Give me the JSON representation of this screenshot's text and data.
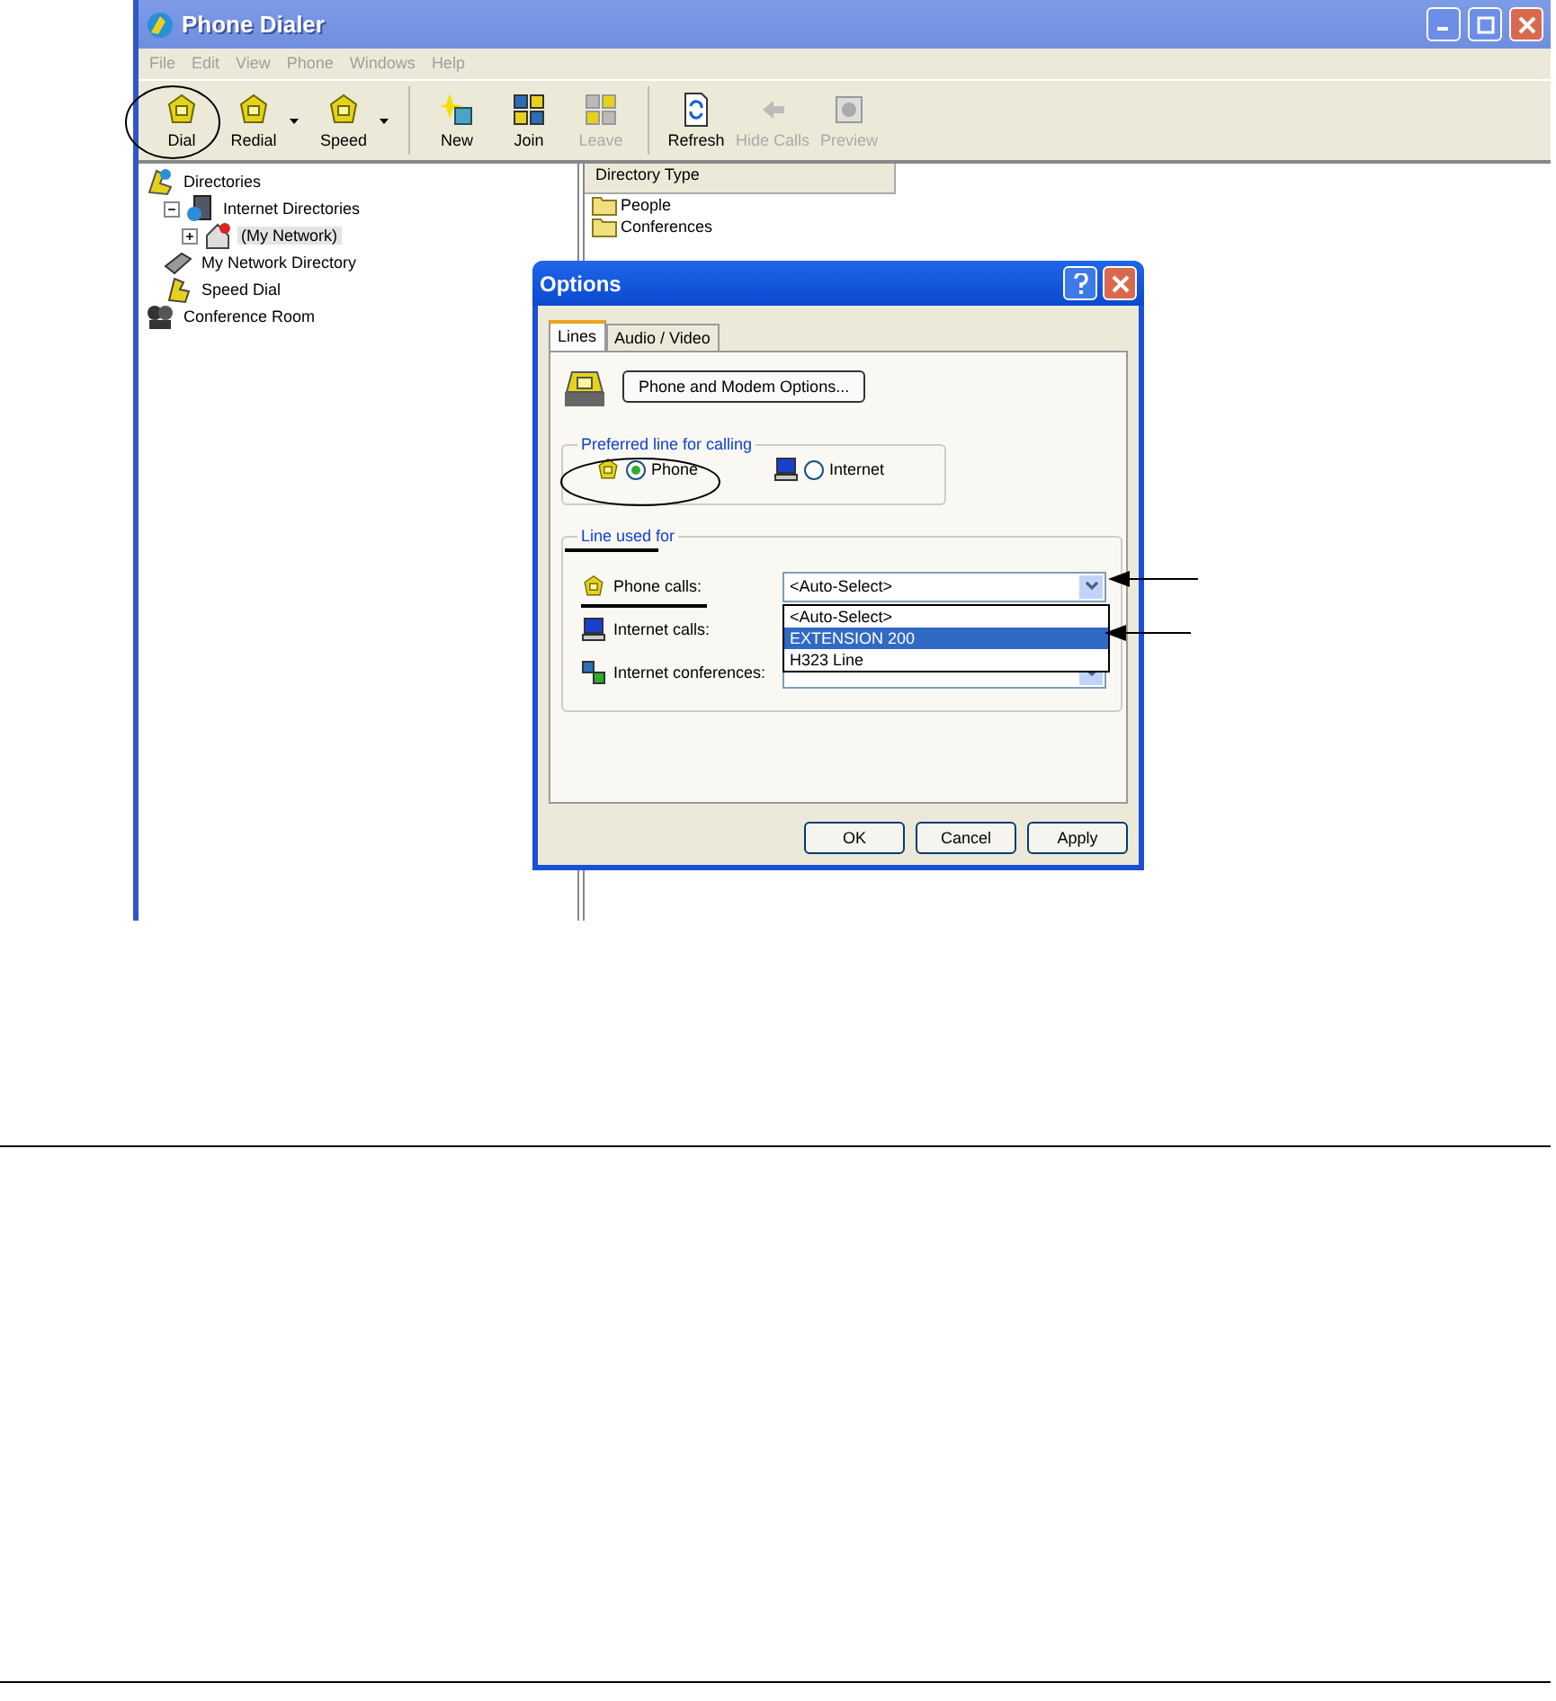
{
  "window": {
    "title": "Phone Dialer"
  },
  "menu": [
    "File",
    "Edit",
    "View",
    "Phone",
    "Windows",
    "Help"
  ],
  "toolbar": [
    {
      "label": "Dial",
      "disabled": false,
      "dropdown": false
    },
    {
      "label": "Redial",
      "disabled": false,
      "dropdown": true
    },
    {
      "label": "Speed",
      "disabled": false,
      "dropdown": true
    },
    {
      "label": "New",
      "disabled": false,
      "dropdown": false
    },
    {
      "label": "Join",
      "disabled": false,
      "dropdown": false
    },
    {
      "label": "Leave",
      "disabled": true,
      "dropdown": false
    },
    {
      "label": "Refresh",
      "disabled": false,
      "dropdown": false
    },
    {
      "label": "Hide Calls",
      "disabled": true,
      "dropdown": false
    },
    {
      "label": "Preview",
      "disabled": true,
      "dropdown": false
    }
  ],
  "tree": [
    {
      "label": "Directories",
      "children": [
        {
          "label": "Internet Directories",
          "expanded": true,
          "children": [
            {
              "label": "(My Network)",
              "expanded": false,
              "selected": true
            }
          ]
        },
        {
          "label": "My Network Directory",
          "selected": false
        },
        {
          "label": "Speed Dial",
          "selected": false
        }
      ]
    },
    {
      "label": "Conference Room",
      "selected": false
    }
  ],
  "list": {
    "column": "Directory Type",
    "items": [
      "People",
      "Conferences"
    ]
  },
  "dialog": {
    "title": "Options",
    "tabs": [
      {
        "label": "Lines",
        "selected": true
      },
      {
        "label": "Audio / Video",
        "selected": false
      }
    ],
    "options_button": "Phone and Modem Options...",
    "preferred": {
      "title": "Preferred line for calling",
      "radios": [
        {
          "label": "Phone",
          "selected": true
        },
        {
          "label": "Internet",
          "selected": false
        }
      ]
    },
    "line_used": {
      "title": "Line used for",
      "rows": [
        {
          "kind": "select",
          "label": "Phone calls:",
          "value": "<Auto-Select>"
        },
        {
          "kind": "label",
          "label": "Internet calls:"
        },
        {
          "kind": "select",
          "label": "Internet conferences:"
        }
      ]
    },
    "dropdown": [
      {
        "label": "<Auto-Select>",
        "selected": false
      },
      {
        "label": "EXTENSION 200",
        "selected": true
      },
      {
        "label": "H323 Line",
        "selected": false
      }
    ],
    "buttons": [
      "OK",
      "Cancel",
      "Apply"
    ]
  }
}
